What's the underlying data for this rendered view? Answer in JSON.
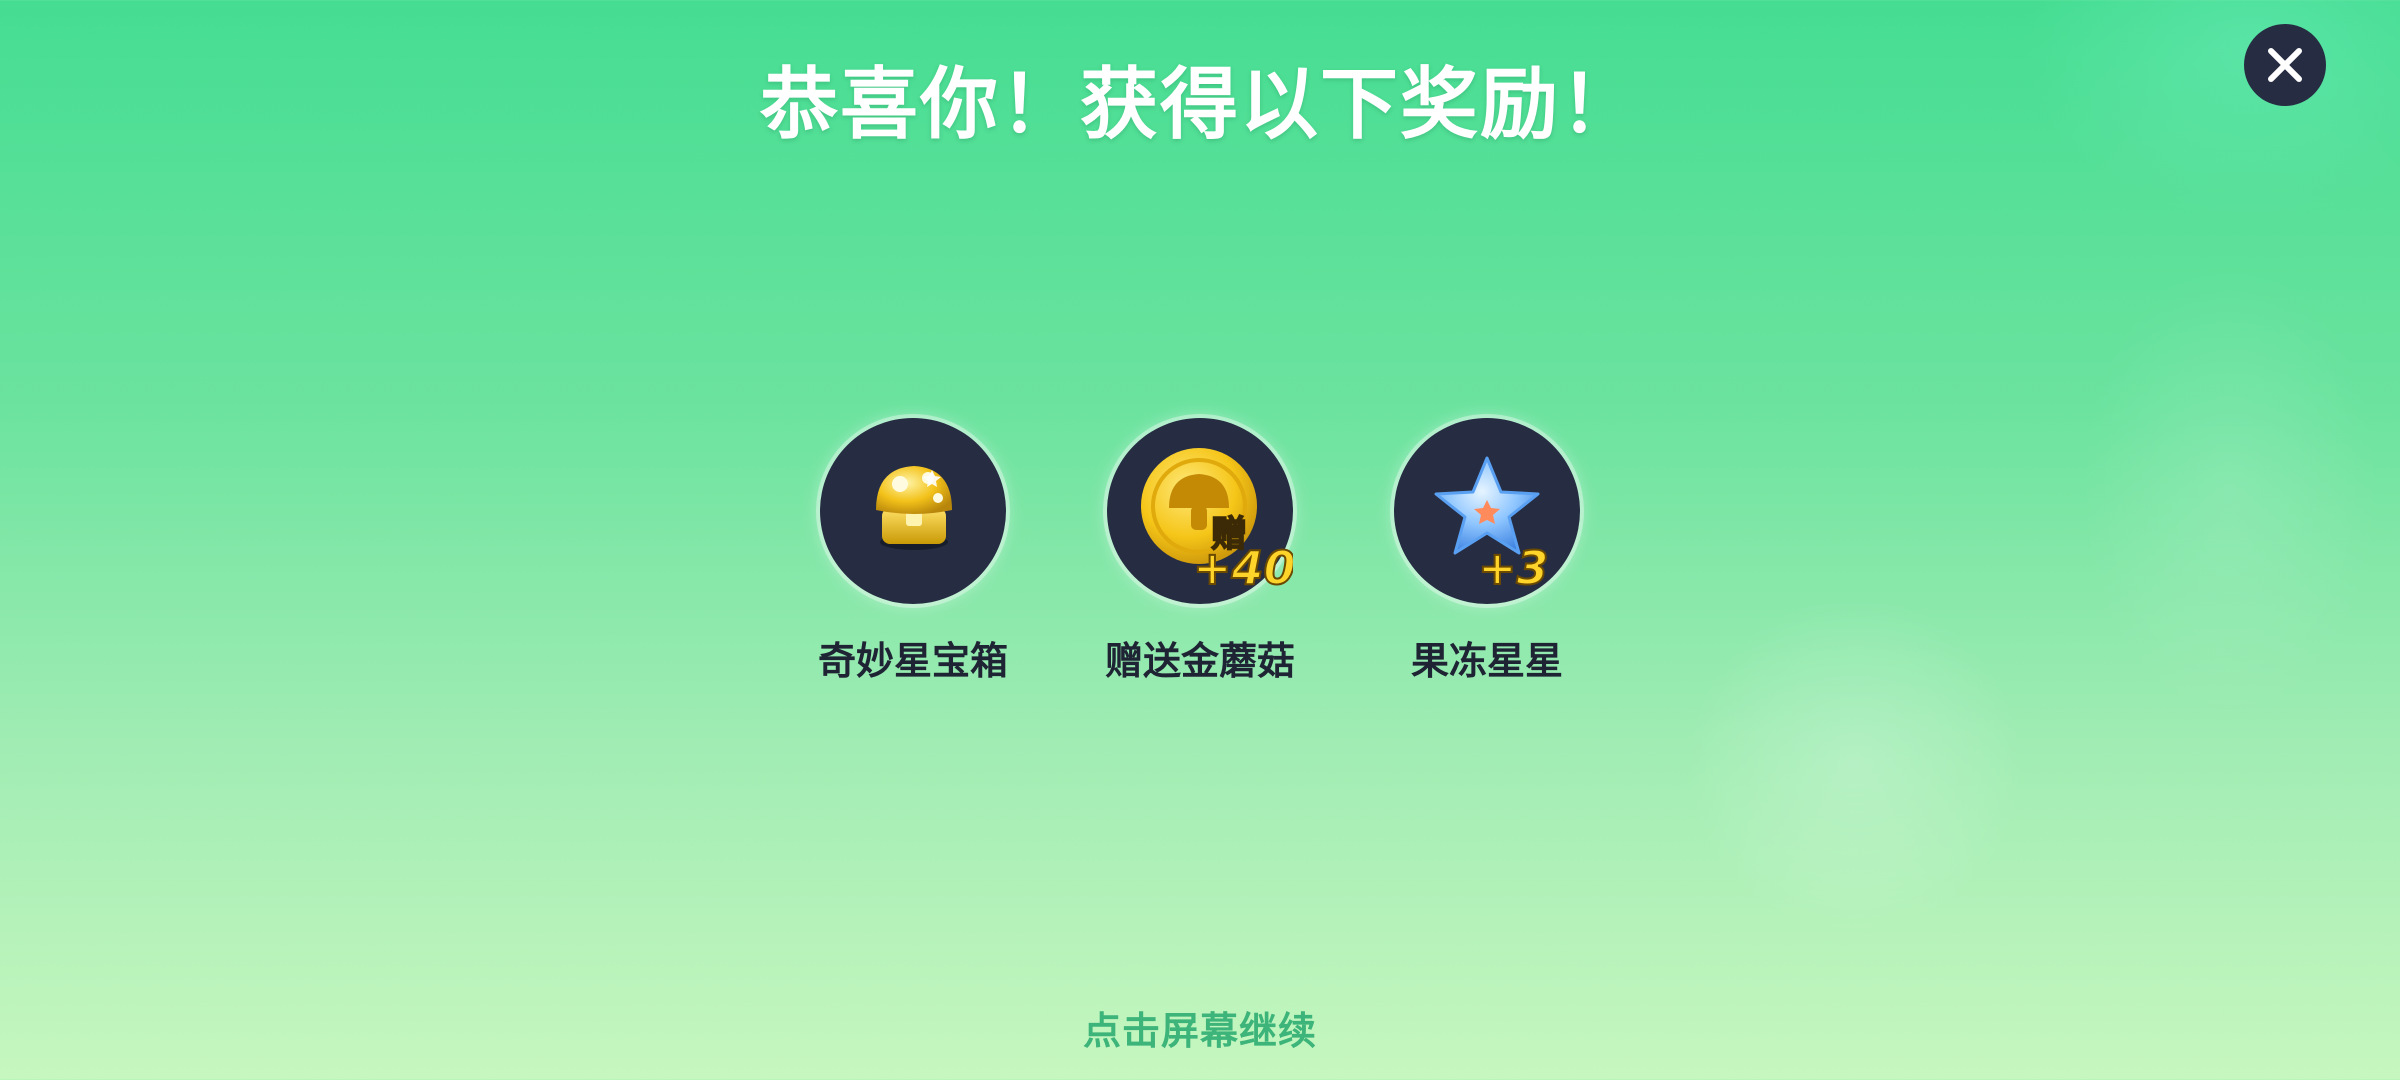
{
  "header": {
    "title": "恭喜你！获得以下奖励！"
  },
  "close_button": {
    "icon": "close-icon"
  },
  "rewards": [
    {
      "label": "奇妙星宝箱",
      "icon": "golden-mushroom-chest-icon",
      "badge": ""
    },
    {
      "label": "赠送金蘑菇",
      "icon": "gold-mushroom-coin-icon",
      "badge_char": "赠",
      "badge": "+40"
    },
    {
      "label": "果冻星星",
      "icon": "jelly-star-icon",
      "badge": "+3"
    }
  ],
  "footer": {
    "hint": "点击屏幕继续"
  },
  "colors": {
    "background_top": "#45dd92",
    "background_bottom": "#c6f7bf",
    "disc": "#262d43",
    "label": "#1f2434",
    "hint": "#3db47a",
    "gold": "#f5c518"
  }
}
